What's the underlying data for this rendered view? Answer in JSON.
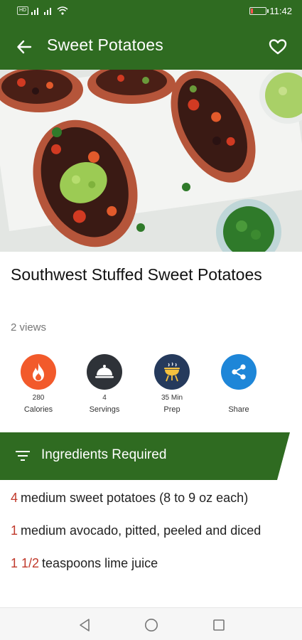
{
  "status_bar": {
    "left_tag": "HD",
    "time": "11:42"
  },
  "app_bar": {
    "title": "Sweet Potatoes"
  },
  "recipe": {
    "title": "Southwest Stuffed Sweet Potatoes",
    "views": "2 views"
  },
  "stats": [
    {
      "value": "280",
      "label": "Calories",
      "icon": "flame-icon",
      "color": "#f25a2b"
    },
    {
      "value": "4",
      "label": "Servings",
      "icon": "serving-dish-icon",
      "color": "#2e3238"
    },
    {
      "value": "35 Min",
      "label": "Prep",
      "icon": "grill-icon",
      "color": "#253a5c"
    },
    {
      "value": "",
      "label": "Share",
      "icon": "share-icon",
      "color": "#1e86d8"
    }
  ],
  "ingredients_header": {
    "title": "Ingredients Required",
    "color": "#2f6b21"
  },
  "ingredients": [
    {
      "qty": "4",
      "text": "medium sweet potatoes (8 to 9 oz each)"
    },
    {
      "qty": "1",
      "text": "medium avocado, pitted, peeled and diced"
    },
    {
      "qty": "1 1/2",
      "text": "teaspoons lime juice"
    }
  ],
  "colors": {
    "primary": "#2f6b21",
    "quantity": "#c0392b"
  }
}
